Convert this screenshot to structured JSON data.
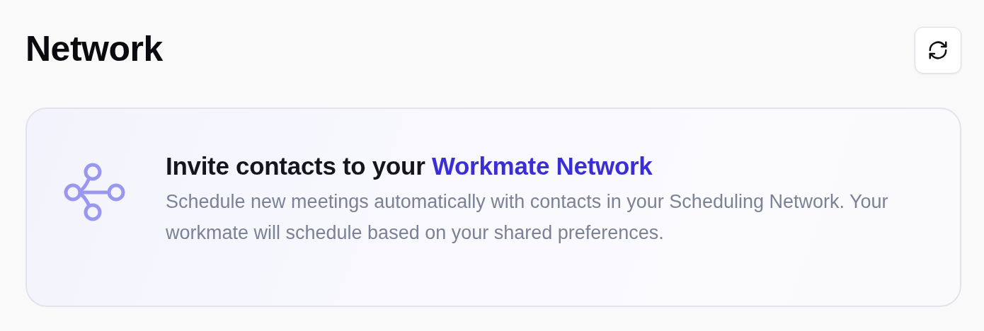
{
  "page": {
    "title": "Network"
  },
  "card": {
    "title": "Invite contacts to your ",
    "title_highlight": "Workmate Network",
    "description": "Schedule new meetings automatically with contacts in your Scheduling Network. Your workmate will schedule based on your shared preferences."
  }
}
